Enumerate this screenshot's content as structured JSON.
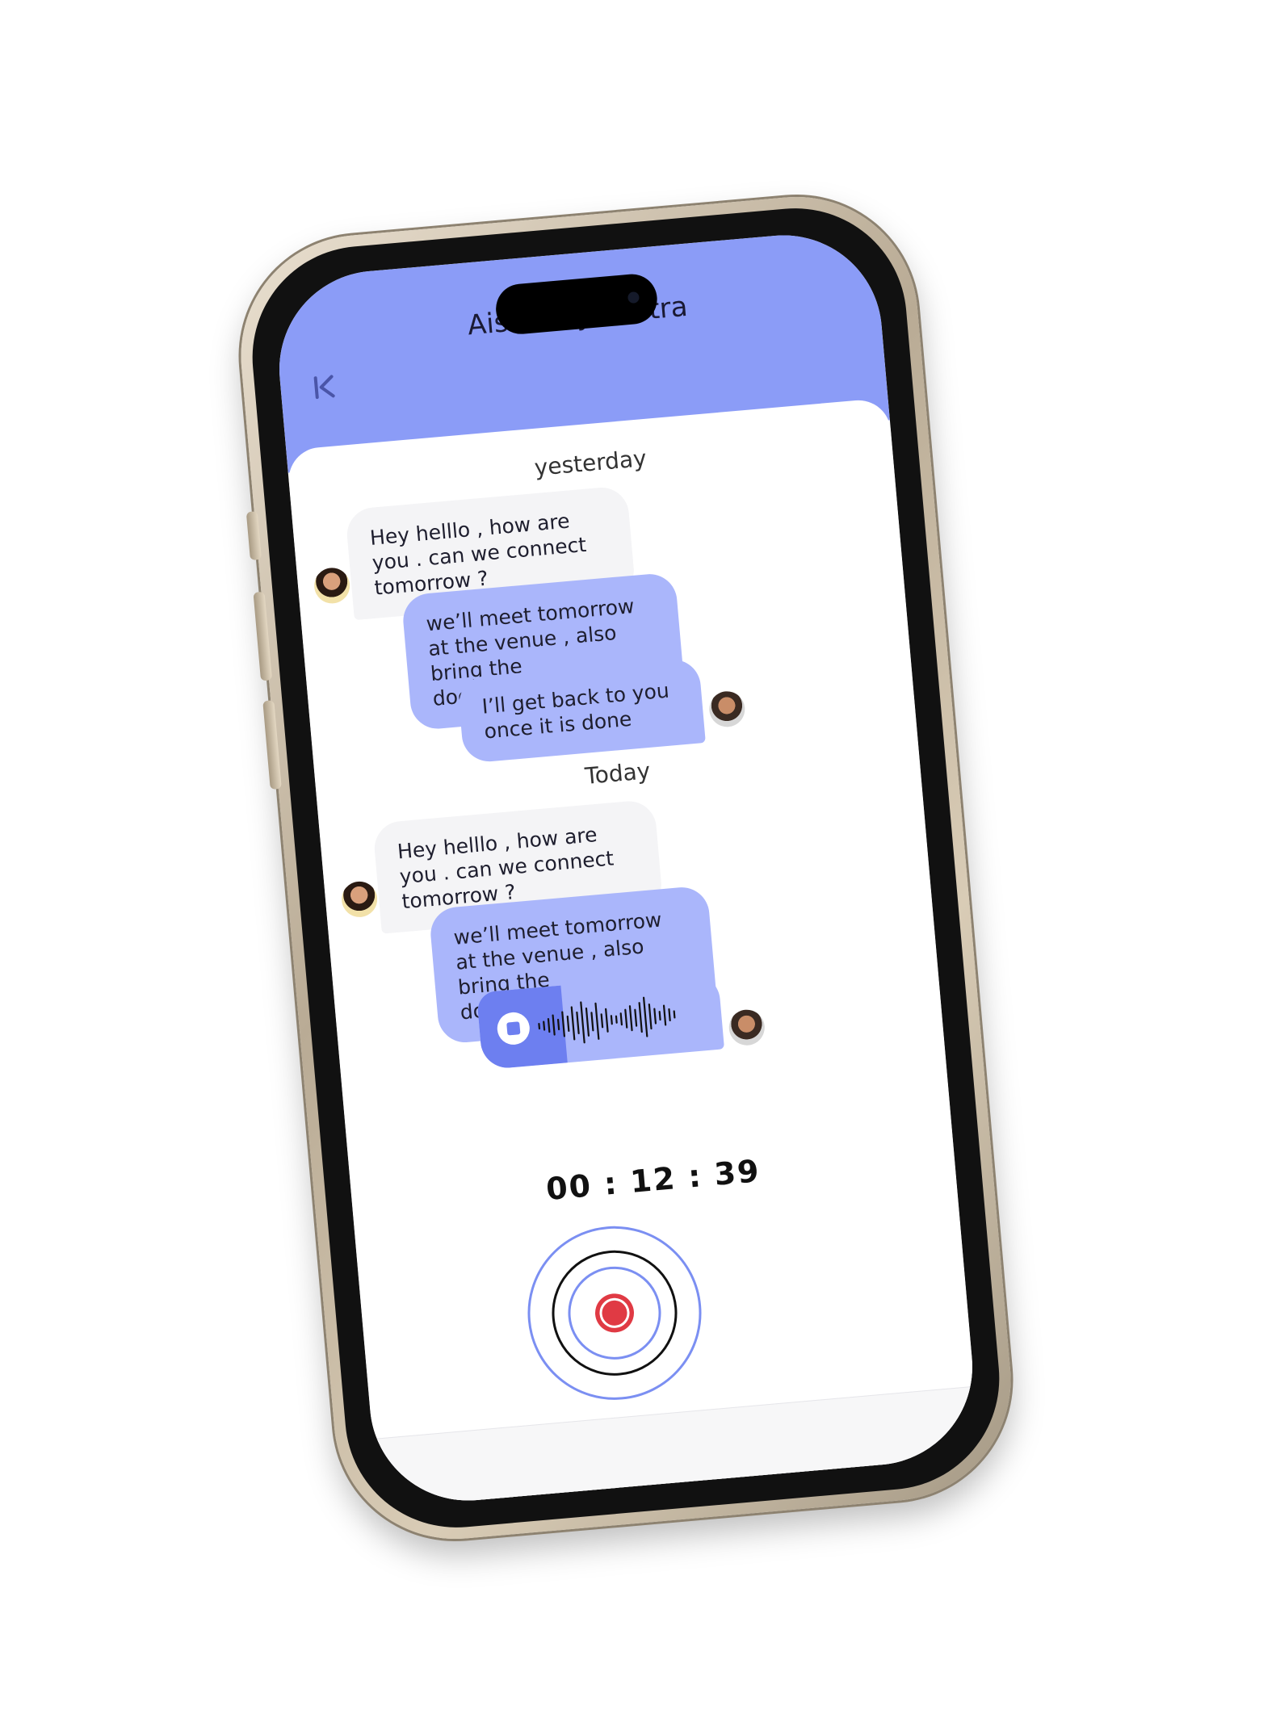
{
  "contact": {
    "name": "Aishwarya Mitra"
  },
  "sections": [
    {
      "label": "yesterday"
    },
    {
      "label": "Today"
    }
  ],
  "messages": [
    {
      "direction": "in",
      "text": "Hey helllo , how are you . can we connect tomorrow ?"
    },
    {
      "direction": "out",
      "text": "we’ll meet tomorrow at the venue , also bring the documents......"
    },
    {
      "direction": "out",
      "text": "I’ll get back to you once it is done"
    },
    {
      "direction": "in",
      "text": "Hey helllo , how are you . can we connect tomorrow ?"
    },
    {
      "direction": "out",
      "text": "we’ll meet tomorrow at the venue , also bring the documents......"
    }
  ],
  "voice_message": {
    "progress": 0.35
  },
  "recorder": {
    "timer": "00 : 12 : 39"
  },
  "colors": {
    "header": "#8b9cf7",
    "outgoing_bubble": "#aab6fb",
    "incoming_bubble": "#f4f4f6",
    "voice_played": "#6d7ff0",
    "record_red": "#e03a44",
    "ring_blue": "#7b8ff2"
  },
  "icons": {
    "back": "back-chevron-icon",
    "stop": "stop-icon",
    "record": "record-icon"
  }
}
